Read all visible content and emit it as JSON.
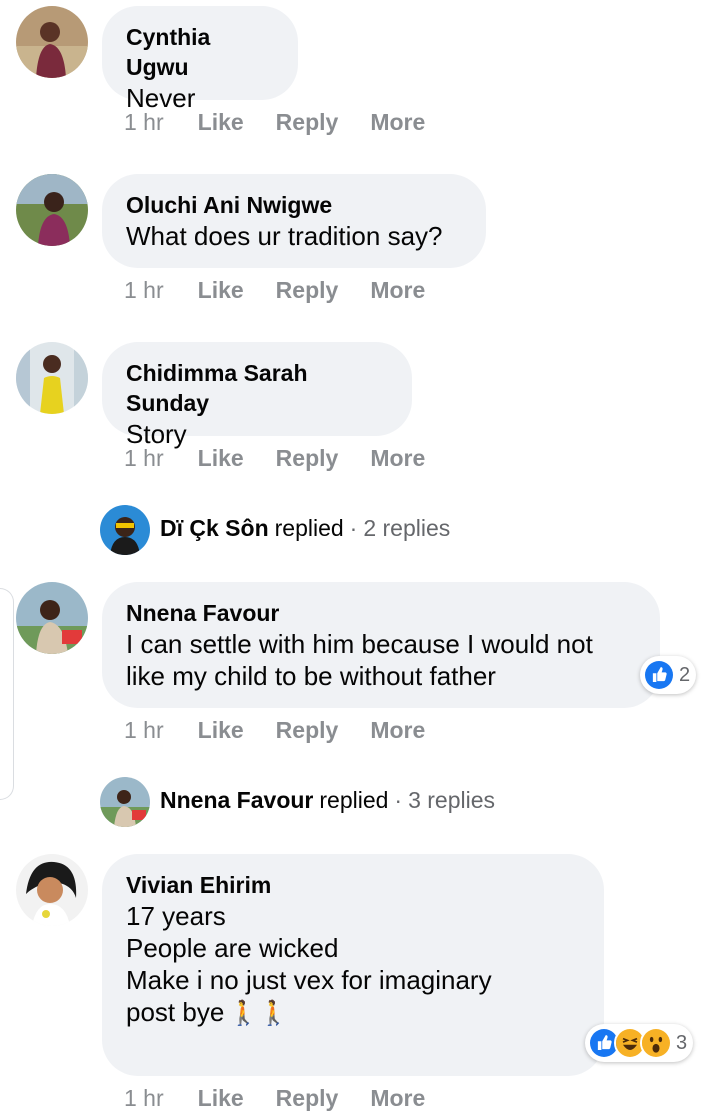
{
  "comments": [
    {
      "author": "Cynthia Ugwu",
      "text": "Never",
      "time": "1 hr",
      "like": "Like",
      "reply": "Reply",
      "more": "More"
    },
    {
      "author": "Oluchi Ani Nwigwe",
      "text": "What does ur tradition say?",
      "time": "1 hr",
      "like": "Like",
      "reply": "Reply",
      "more": "More"
    },
    {
      "author": "Chidimma Sarah Sunday",
      "text": "Story",
      "time": "1 hr",
      "like": "Like",
      "reply": "Reply",
      "more": "More",
      "replies_preview": {
        "name": "Dï Çk Sôn",
        "word": "replied",
        "sep": "·",
        "count": "2 replies"
      }
    },
    {
      "author": "Nnena Favour",
      "text": "I can settle with him because I would not\nlike my child to be without father",
      "time": "1 hr",
      "like": "Like",
      "reply": "Reply",
      "more": "More",
      "reaction_icons": [
        "like-icon"
      ],
      "reaction_count": "2",
      "replies_preview": {
        "name": "Nnena Favour",
        "word": "replied",
        "sep": "·",
        "count": "3 replies"
      }
    },
    {
      "author": "Vivian Ehirim",
      "text_line1": "17 years",
      "text_line2": "People are wicked\nMake i no just vex for imaginary\npost bye",
      "emoji": "🚶🚶",
      "time": "1 hr",
      "like": "Like",
      "reply": "Reply",
      "more": "More",
      "reaction_icons": [
        "like-icon",
        "haha-icon",
        "wow-icon"
      ],
      "reaction_count": "3"
    }
  ],
  "colors": {
    "bubble": "#f0f2f5",
    "meta_text": "#8a8d91",
    "like_blue": "#1877f2",
    "emoji_yellow": "#f7b125"
  }
}
